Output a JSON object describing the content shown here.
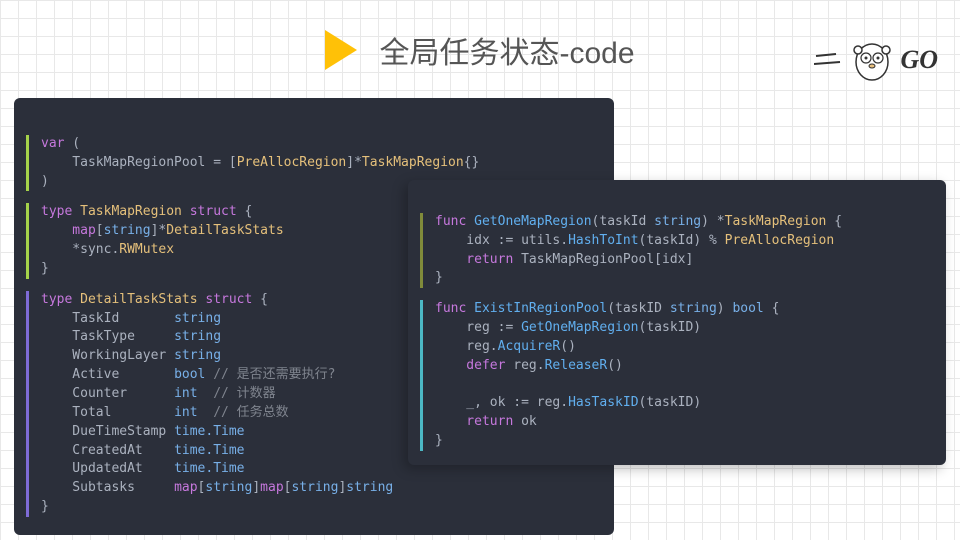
{
  "title": "全局任务状态-code",
  "go_label": "GO",
  "left": {
    "block1": {
      "l1a": "var",
      "l1b": " (",
      "l2a": "    TaskMapRegionPool",
      "l2b": " = [",
      "l2c": "PreAllocRegion",
      "l2d": "]*",
      "l2e": "TaskMapRegion",
      "l2f": "{}",
      "l3": ")"
    },
    "block2": {
      "l1a": "type",
      "l1b": " TaskMapRegion",
      "l1c": " struct",
      "l1d": " {",
      "l2a": "    map",
      "l2b": "[",
      "l2c": "string",
      "l2d": "]*",
      "l2e": "DetailTaskStats",
      "l3a": "    *",
      "l3b": "sync",
      "l3c": ".",
      "l3d": "RWMutex",
      "l4": "}"
    },
    "block3": {
      "l1a": "type",
      "l1b": " DetailTaskStats",
      "l1c": " struct",
      "l1d": " {",
      "fields": [
        {
          "name": "    TaskId       ",
          "type": "string",
          "comment": ""
        },
        {
          "name": "    TaskType     ",
          "type": "string",
          "comment": ""
        },
        {
          "name": "    WorkingLayer ",
          "type": "string",
          "comment": ""
        },
        {
          "name": "    Active       ",
          "type": "bool",
          "comment": " // 是否还需要执⾏?"
        },
        {
          "name": "    Counter      ",
          "type": "int ",
          "comment": " // 计数器"
        },
        {
          "name": "    Total        ",
          "type": "int ",
          "comment": " // 任务总数"
        },
        {
          "name": "    DueTimeStamp ",
          "type": "time.Time",
          "comment": ""
        },
        {
          "name": "    CreatedAt    ",
          "type": "time.Time",
          "comment": ""
        },
        {
          "name": "    UpdatedAt    ",
          "type": "time.Time",
          "comment": ""
        }
      ],
      "sub_a": "    Subtasks     ",
      "sub_b": "map",
      "sub_c": "[",
      "sub_d": "string",
      "sub_e": "]",
      "sub_f": "map",
      "sub_g": "[",
      "sub_h": "string",
      "sub_i": "]",
      "sub_j": "string",
      "end": "}"
    }
  },
  "right": {
    "fn1": {
      "l1a": "func",
      "l1b": " GetOneMapRegion",
      "l1c": "(taskId ",
      "l1d": "string",
      "l1e": ") *",
      "l1f": "TaskMapRegion",
      "l1g": " {",
      "l2a": "    idx ",
      "l2b": ":=",
      "l2c": " utils.",
      "l2d": "HashToInt",
      "l2e": "(taskId) % ",
      "l2f": "PreAllocRegion",
      "l3a": "    return",
      "l3b": " TaskMapRegionPool[idx]",
      "l4": "}"
    },
    "fn2": {
      "l1a": "func",
      "l1b": " ExistInRegionPool",
      "l1c": "(taskID ",
      "l1d": "string",
      "l1e": ") ",
      "l1f": "bool",
      "l1g": " {",
      "l2a": "    reg ",
      "l2b": ":=",
      "l2c": " ",
      "l2d": "GetOneMapRegion",
      "l2e": "(taskID)",
      "l3a": "    reg.",
      "l3b": "AcquireR",
      "l3c": "()",
      "l4a": "    defer",
      "l4b": " reg.",
      "l4c": "ReleaseR",
      "l4d": "()",
      "blank": "",
      "l5a": "    _, ok ",
      "l5b": ":=",
      "l5c": " reg.",
      "l5d": "HasTaskID",
      "l5e": "(taskID)",
      "l6a": "    return",
      "l6b": " ok",
      "l7": "}"
    }
  }
}
